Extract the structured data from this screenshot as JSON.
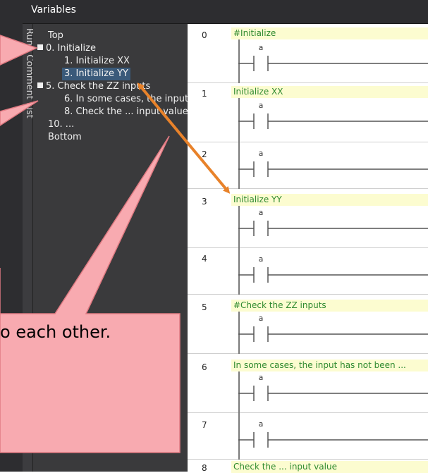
{
  "window": {
    "title": "Variables"
  },
  "sidebar_tab": {
    "label": "Rung Comment List"
  },
  "tree": {
    "items": [
      {
        "label": "Top",
        "level": 0,
        "expander": false,
        "selected": false
      },
      {
        "label": "0. Initialize",
        "level": 0,
        "expander": true,
        "selected": false
      },
      {
        "label": "1. Initialize XX",
        "level": 1,
        "expander": false,
        "selected": false
      },
      {
        "label": "3. Initialize YY",
        "level": 1,
        "expander": false,
        "selected": true
      },
      {
        "label": "5. Check the ZZ inputs",
        "level": 0,
        "expander": true,
        "selected": false
      },
      {
        "label": "6. In some cases, the input",
        "level": 1,
        "expander": false,
        "selected": false
      },
      {
        "label": "8. Check the ... input value",
        "level": 1,
        "expander": false,
        "selected": false
      },
      {
        "label": "10. ...",
        "level": 0,
        "expander": false,
        "selected": false
      },
      {
        "label": "Bottom",
        "level": 0,
        "expander": false,
        "selected": false
      }
    ]
  },
  "ladder": {
    "contact_label": "a",
    "rungs": [
      {
        "number": "0",
        "comment": "#Initialize"
      },
      {
        "number": "1",
        "comment": "Initialize XX"
      },
      {
        "number": "2",
        "comment": ""
      },
      {
        "number": "3",
        "comment": "Initialize YY"
      },
      {
        "number": "4",
        "comment": ""
      },
      {
        "number": "5",
        "comment": "#Check the ZZ inputs"
      },
      {
        "number": "6",
        "comment": "In some cases, the input has not been ..."
      },
      {
        "number": "7",
        "comment": ""
      },
      {
        "number": "8",
        "comment": "Check the ... input value"
      }
    ]
  },
  "callout": {
    "text": "o each other."
  },
  "colors": {
    "callout_fill": "#f8aab0",
    "callout_edge": "#e07a82",
    "arrow": "#e8822a",
    "comment_bg": "#fcfcd0",
    "comment_text": "#2f8a2f",
    "panel_bg": "#3a3a3c"
  }
}
